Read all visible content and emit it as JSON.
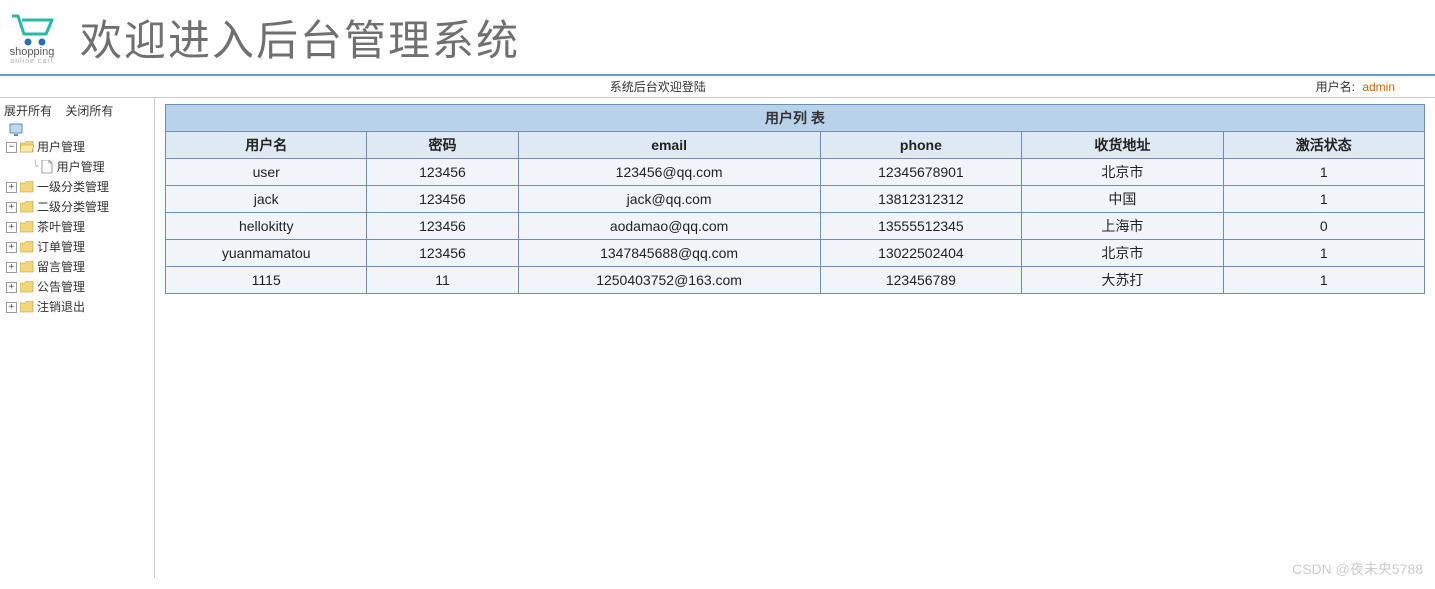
{
  "header": {
    "logo_label": "shopping",
    "logo_sub": "online cart",
    "title": "欢迎进入后台管理系统"
  },
  "topbar": {
    "welcome": "系统后台欢迎登陆",
    "user_label": "用户名:",
    "username": "admin"
  },
  "tree": {
    "expand_all": "展开所有",
    "collapse_all": "关闭所有",
    "nodes": [
      {
        "label": "用户管理",
        "expanded": true,
        "children": [
          {
            "label": "用户管理"
          }
        ]
      },
      {
        "label": "一级分类管理",
        "expanded": false
      },
      {
        "label": "二级分类管理",
        "expanded": false
      },
      {
        "label": "茶叶管理",
        "expanded": false
      },
      {
        "label": "订单管理",
        "expanded": false
      },
      {
        "label": "留言管理",
        "expanded": false
      },
      {
        "label": "公告管理",
        "expanded": false
      },
      {
        "label": "注销退出",
        "expanded": false
      }
    ]
  },
  "table": {
    "caption": "用户列 表",
    "headers": [
      "用户名",
      "密码",
      "email",
      "phone",
      "收货地址",
      "激活状态"
    ],
    "rows": [
      [
        "user",
        "123456",
        "123456@qq.com",
        "12345678901",
        "北京市",
        "1"
      ],
      [
        "jack",
        "123456",
        "jack@qq.com",
        "13812312312",
        "中国",
        "1"
      ],
      [
        "hellokitty",
        "123456",
        "aodamao@qq.com",
        "13555512345",
        "上海市",
        "0"
      ],
      [
        "yuanmamatou",
        "123456",
        "1347845688@qq.com",
        "13022502404",
        "北京市",
        "1"
      ],
      [
        "1115",
        "11",
        "1250403752@163.com",
        "123456789",
        "大苏打",
        "1"
      ]
    ]
  },
  "watermark": "CSDN @夜未央5788"
}
